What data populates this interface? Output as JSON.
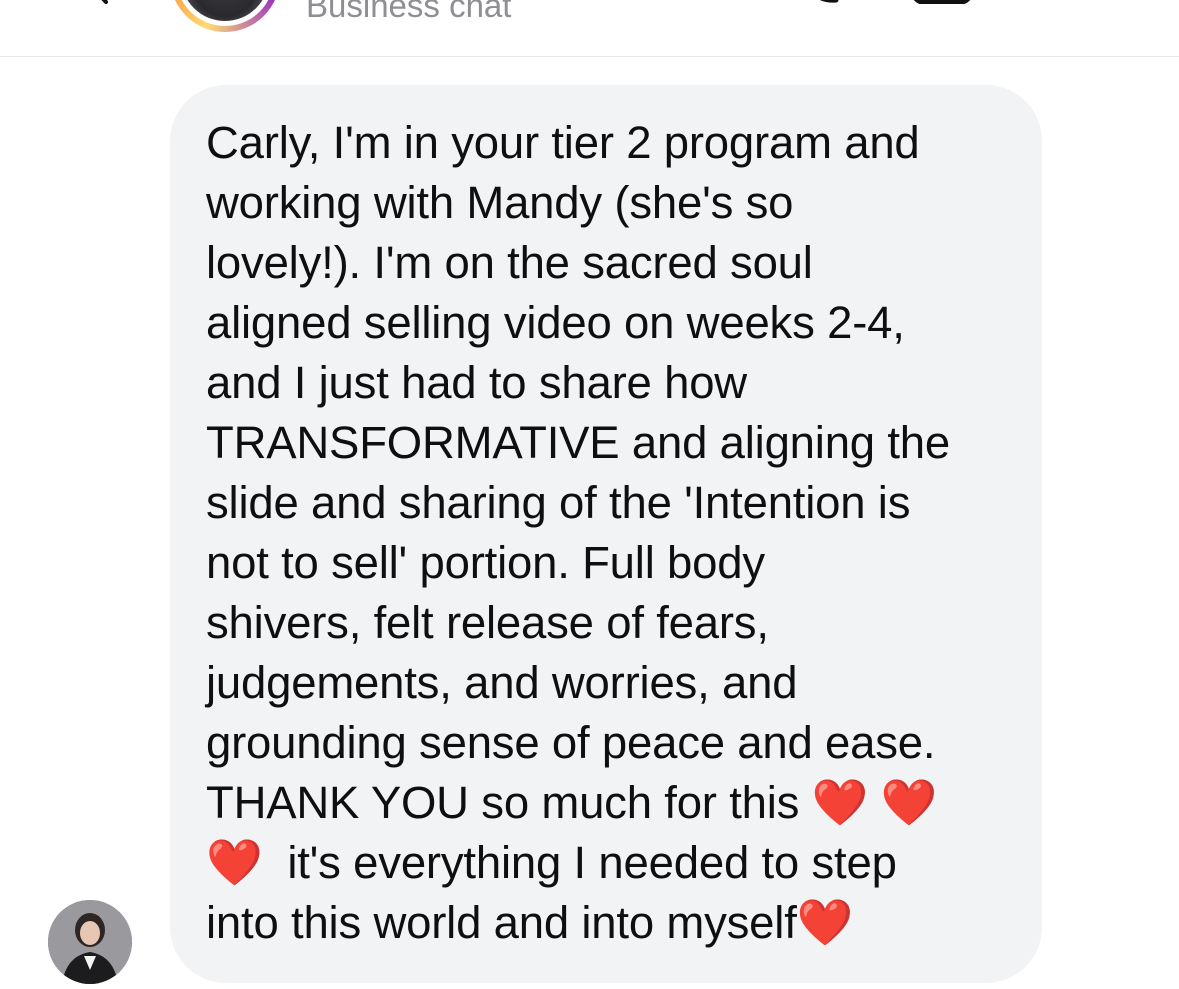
{
  "header": {
    "subtitle": "Business chat",
    "icons": [
      "back-icon",
      "profile-avatar",
      "phone-icon",
      "video-icon",
      "info-icon"
    ]
  },
  "conversation": {
    "messages": [
      {
        "direction": "incoming",
        "text": "Carly, I'm in your tier 2 program and\nworking with Mandy (she's so\nlovely!). I'm on the sacred soul\naligned selling video on weeks 2-4,\nand I just had to share how\nTRANSFORMATIVE and aligning the\nslide and sharing of the 'Intention is\nnot to sell' portion. Full body\nshivers, felt release of fears,\njudgements, and worries, and\ngrounding sense of peace and ease.\nTHANK YOU so much for this ❤️ ❤️\n❤️  it's everything I needed to step\ninto this world and into myself❤️"
      }
    ]
  },
  "colors": {
    "bubble_background": "#f2f3f5",
    "subtitle_gray": "#8e8e93",
    "story_ring": [
      "#feda75",
      "#fa7e1e",
      "#d62976",
      "#962fbf"
    ]
  }
}
